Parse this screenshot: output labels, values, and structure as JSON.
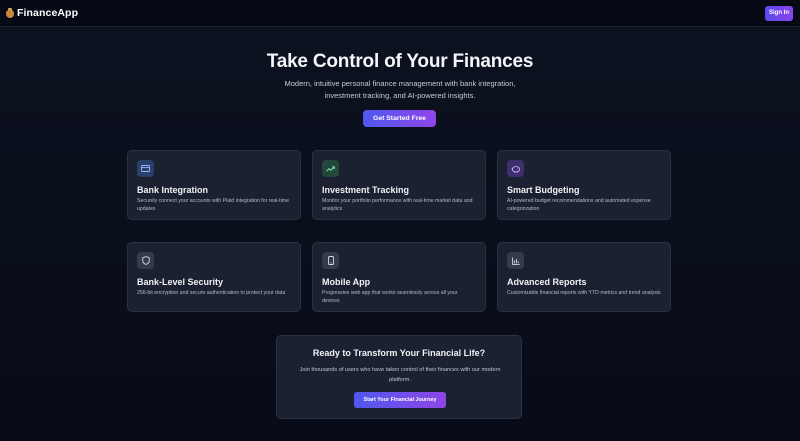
{
  "navbar": {
    "brand_name": "FinanceApp",
    "signin_label": "Sign In"
  },
  "hero": {
    "title": "Take Control of Your Finances",
    "subtitle": "Modern, intuitive personal finance management with bank integration, investment tracking, and AI-powered insights.",
    "cta_label": "Get Started Free"
  },
  "features": [
    {
      "icon": "credit-card-icon",
      "title": "Bank Integration",
      "description": "Securely connect your accounts with Plaid integration for real-time updates"
    },
    {
      "icon": "trending-up-icon",
      "title": "Investment Tracking",
      "description": "Monitor your portfolio performance with real-time market data and analytics"
    },
    {
      "icon": "piggy-bank-icon",
      "title": "Smart Budgeting",
      "description": "AI-powered budget recommendations and automated expense categorization"
    },
    {
      "icon": "shield-icon",
      "title": "Bank-Level Security",
      "description": "256-bit encryption and secure authentication to protect your data"
    },
    {
      "icon": "smartphone-icon",
      "title": "Mobile App",
      "description": "Progressive web app that works seamlessly across all your devices"
    },
    {
      "icon": "bar-chart-icon",
      "title": "Advanced Reports",
      "description": "Customizable financial reports with YTD metrics and trend analysis"
    }
  ],
  "cta_section": {
    "title": "Ready to Transform Your Financial Life?",
    "description": "Join thousands of users who have taken control of their finances with our modern platform.",
    "button_label": "Start Your Financial Journey"
  },
  "colors": {
    "background": "#0a0f1c",
    "card": "#1b2130",
    "accent_start": "#4f58ee",
    "accent_end": "#8f45e8"
  }
}
